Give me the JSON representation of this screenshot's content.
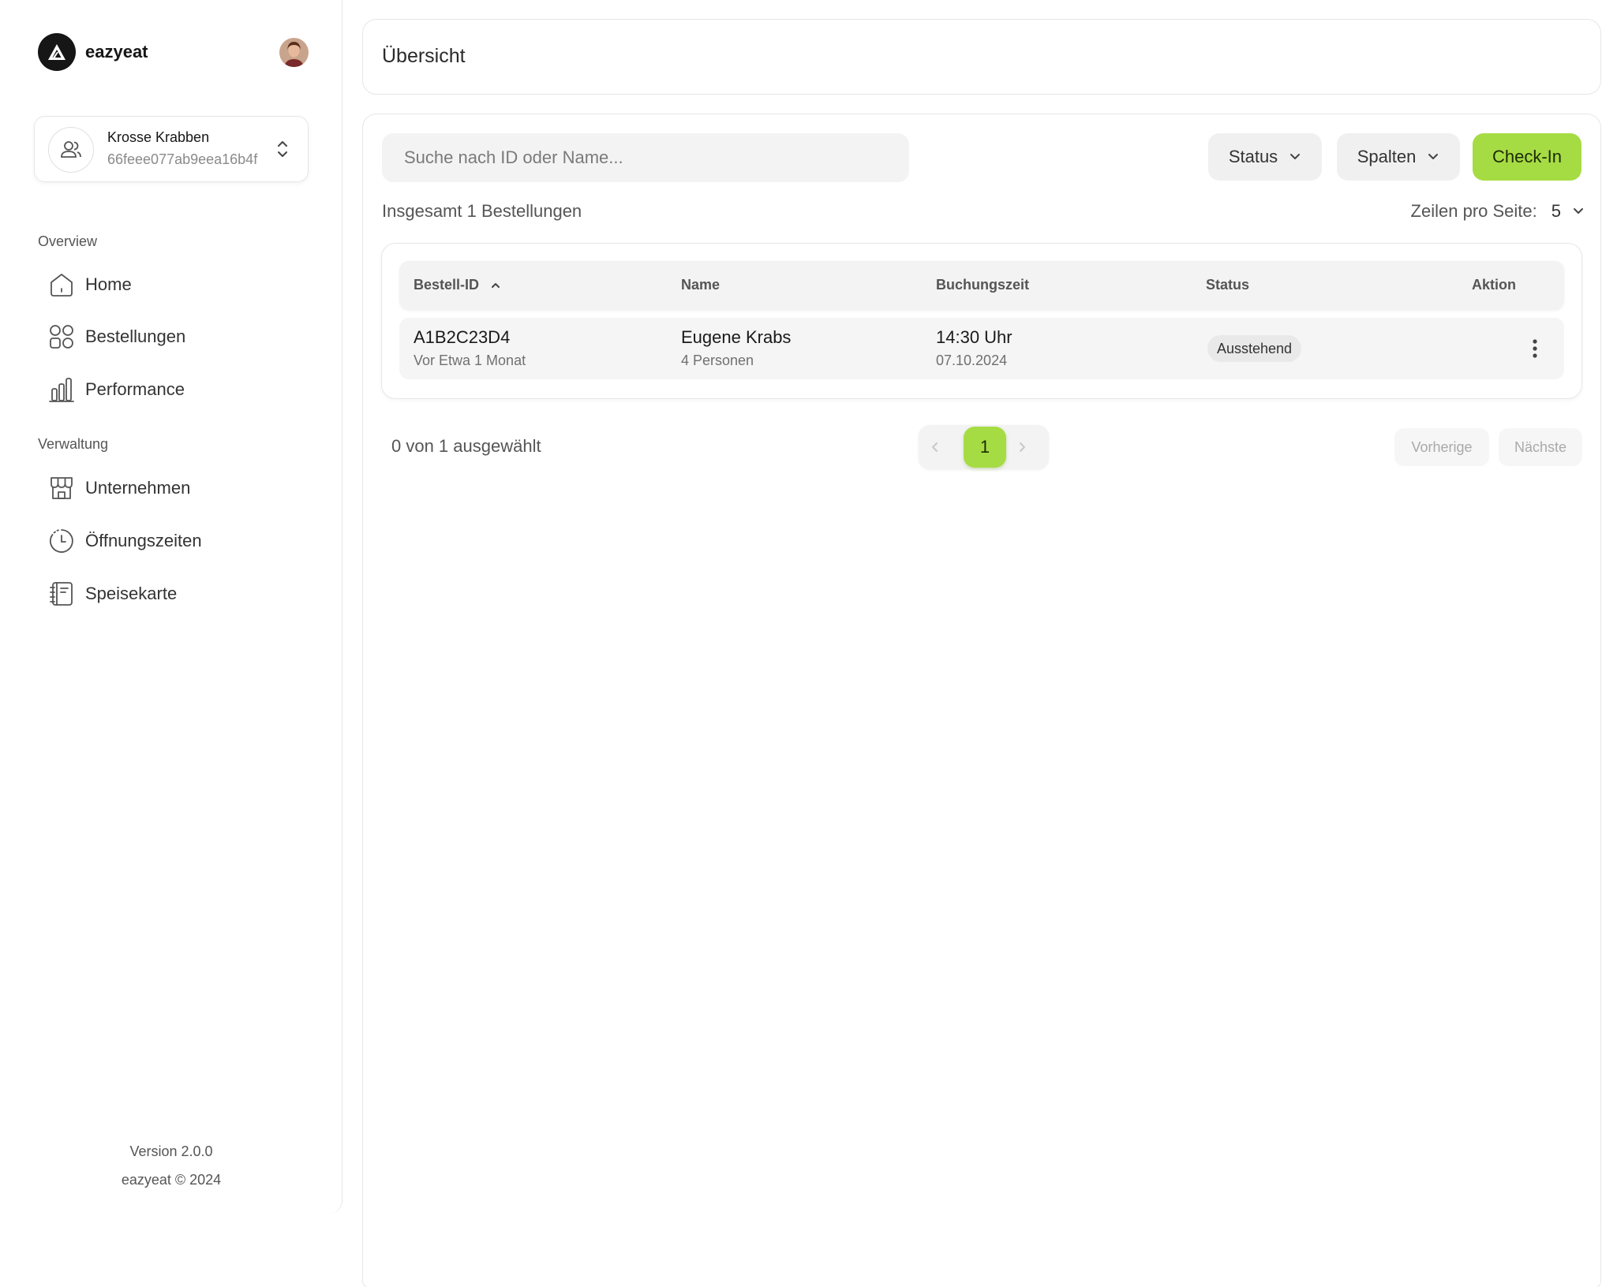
{
  "app": {
    "brand_name": "eazyeat"
  },
  "organization": {
    "name": "Krosse Krabben",
    "id": "66feee077ab9eea16b4f"
  },
  "sidebar": {
    "sections": [
      {
        "title": "Overview",
        "items": [
          {
            "label": "Home",
            "icon": "home-icon"
          },
          {
            "label": "Bestellungen",
            "icon": "grid-icon"
          },
          {
            "label": "Performance",
            "icon": "bar-chart-icon"
          }
        ]
      },
      {
        "title": "Verwaltung",
        "items": [
          {
            "label": "Unternehmen",
            "icon": "store-icon"
          },
          {
            "label": "Öffnungszeiten",
            "icon": "clock-icon"
          },
          {
            "label": "Speisekarte",
            "icon": "menu-book-icon"
          }
        ]
      }
    ],
    "footer": {
      "version": "Version 2.0.0",
      "copyright": "eazyeat © 2024"
    }
  },
  "header": {
    "title": "Übersicht"
  },
  "toolbar": {
    "search_placeholder": "Suche nach ID oder Name...",
    "status_label": "Status",
    "columns_label": "Spalten",
    "checkin_label": "Check-In"
  },
  "summary": {
    "total": "Insgesamt 1 Bestellungen",
    "rows_per_page_label": "Zeilen pro Seite:",
    "rows_per_page_value": "5"
  },
  "table": {
    "columns": [
      "Bestell-ID",
      "Name",
      "Buchungszeit",
      "Status",
      "Aktion"
    ],
    "sort": {
      "column": "Bestell-ID",
      "direction": "ascending"
    },
    "rows": [
      {
        "id": "A1B2C23D4",
        "id_sub": "Vor Etwa 1 Monat",
        "name": "Eugene Krabs",
        "name_sub": "4 Personen",
        "time": "14:30 Uhr",
        "date": "07.10.2024",
        "status": "Ausstehend"
      }
    ]
  },
  "pagination": {
    "selected": "0 von 1 ausgewählt",
    "current_page": "1",
    "prev_label": "Vorherige",
    "next_label": "Nächste"
  },
  "colors": {
    "accent": "#a6dc43",
    "border": "#e6e6e6",
    "surface": "#f3f3f3"
  }
}
